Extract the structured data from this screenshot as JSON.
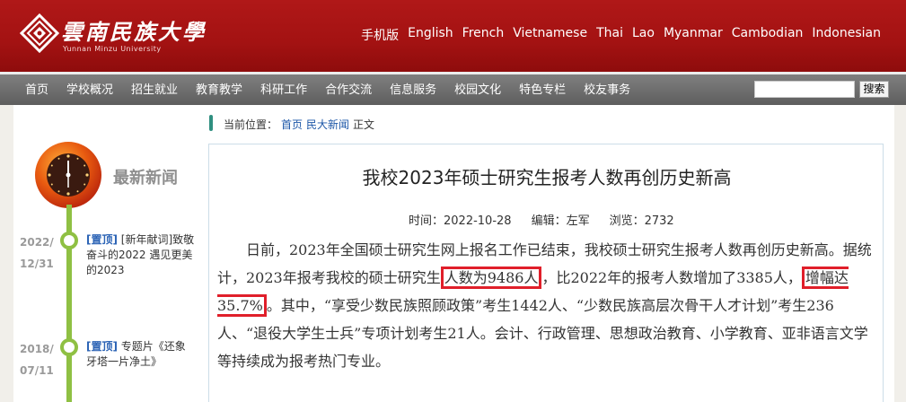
{
  "header": {
    "logo_text": "雲南民族大學",
    "logo_subtext": "Yunnan Minzu University",
    "languages": [
      "手机版",
      "English",
      "French",
      "Vietnamese",
      "Thai",
      "Lao",
      "Myanmar",
      "Cambodian",
      "Indonesian"
    ]
  },
  "nav": {
    "items": [
      "首页",
      "学校概况",
      "招生就业",
      "教育教学",
      "科研工作",
      "合作交流",
      "信息服务",
      "校园文化",
      "特色专栏",
      "校友事务"
    ],
    "search_placeholder": "",
    "search_button": "搜索"
  },
  "breadcrumb": {
    "prefix": "当前位置：",
    "home": "首页",
    "section": "民大新闻",
    "current": "正文"
  },
  "sidebar": {
    "title": "最新新闻",
    "items": [
      {
        "year": "2022/",
        "date": "12/31",
        "tag": "[置顶]",
        "text": " [新年献词]致敬奋斗的2022 遇见更美的2023"
      },
      {
        "year": "2018/",
        "date": "07/11",
        "tag": "[置顶]",
        "text": " 专题片《还象牙塔一片净土》"
      }
    ]
  },
  "article": {
    "title": "我校2023年硕士研究生报考人数再创历史新高",
    "meta": {
      "time": "时间：2022-10-28",
      "editor": "编辑：左军",
      "views": "浏览：2732"
    },
    "p1_a": "日前，2023年全国硕士研究生网上报名工作已结束，我校硕士研究生报考人数再创历史新高。据统计，2023年报考我校的硕士研究生",
    "p1_hl1": "人数为9486人",
    "p1_b": "，比2022年的报考人数增加了3385人，",
    "p1_hl2": "增幅达35.7%",
    "p1_c": "。其中，“享受少数民族照顾政策”考生1442人、“少数民族高层次骨干人才计划”考生236人、“退役大学生士兵”专项计划考生21人。会计、行政管理、思想政治教育、小学教育、亚非语言文学等持续成为报考热门专业。"
  },
  "colors": {
    "header_red": "#a31212",
    "timeline_green": "#8fc043",
    "highlight_red": "#e01f2a",
    "link_blue": "#1d57a8"
  }
}
